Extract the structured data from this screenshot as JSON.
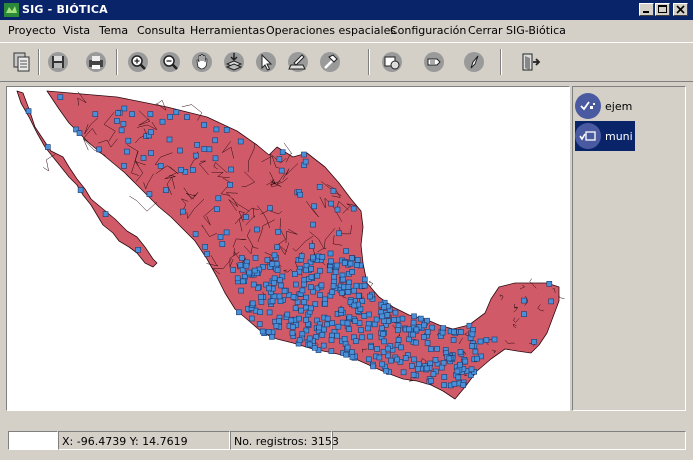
{
  "window": {
    "title": "SIG - BIÓTICA",
    "controls": [
      "minimize",
      "maximize",
      "close"
    ]
  },
  "menu": {
    "items": [
      {
        "label": "Proyecto"
      },
      {
        "label": "Vista"
      },
      {
        "label": "Tema"
      },
      {
        "label": "Consulta"
      },
      {
        "label": "Herramientas"
      },
      {
        "label": "Operaciones espaciales"
      },
      {
        "label": "Configuración"
      },
      {
        "label": "Cerrar SIG-Biótica"
      }
    ]
  },
  "toolbar": {
    "buttons": [
      {
        "icon": "copy-icon"
      },
      {
        "icon": "save-icon"
      },
      {
        "icon": "print-icon"
      },
      {
        "icon": "zoom-in-icon"
      },
      {
        "icon": "zoom-out-icon"
      },
      {
        "icon": "pan-hand-icon"
      },
      {
        "icon": "layer-add-icon"
      },
      {
        "icon": "select-pointer-icon"
      },
      {
        "icon": "edit-table-icon"
      },
      {
        "icon": "hammer-icon"
      },
      {
        "icon": "map-select-icon"
      },
      {
        "icon": "label-icon"
      },
      {
        "icon": "compass-icon"
      },
      {
        "icon": "exit-door-icon"
      }
    ]
  },
  "map": {
    "land_color": "#d05a68",
    "point_color": "#4a90d9",
    "border_color": "#2a0a10"
  },
  "layers": [
    {
      "name": "ejem",
      "selected": false
    },
    {
      "name": "muni",
      "selected": true
    }
  ],
  "status": {
    "coords": "X: -96.4739   Y: 14.7619",
    "records": "No. registros: 3153"
  }
}
